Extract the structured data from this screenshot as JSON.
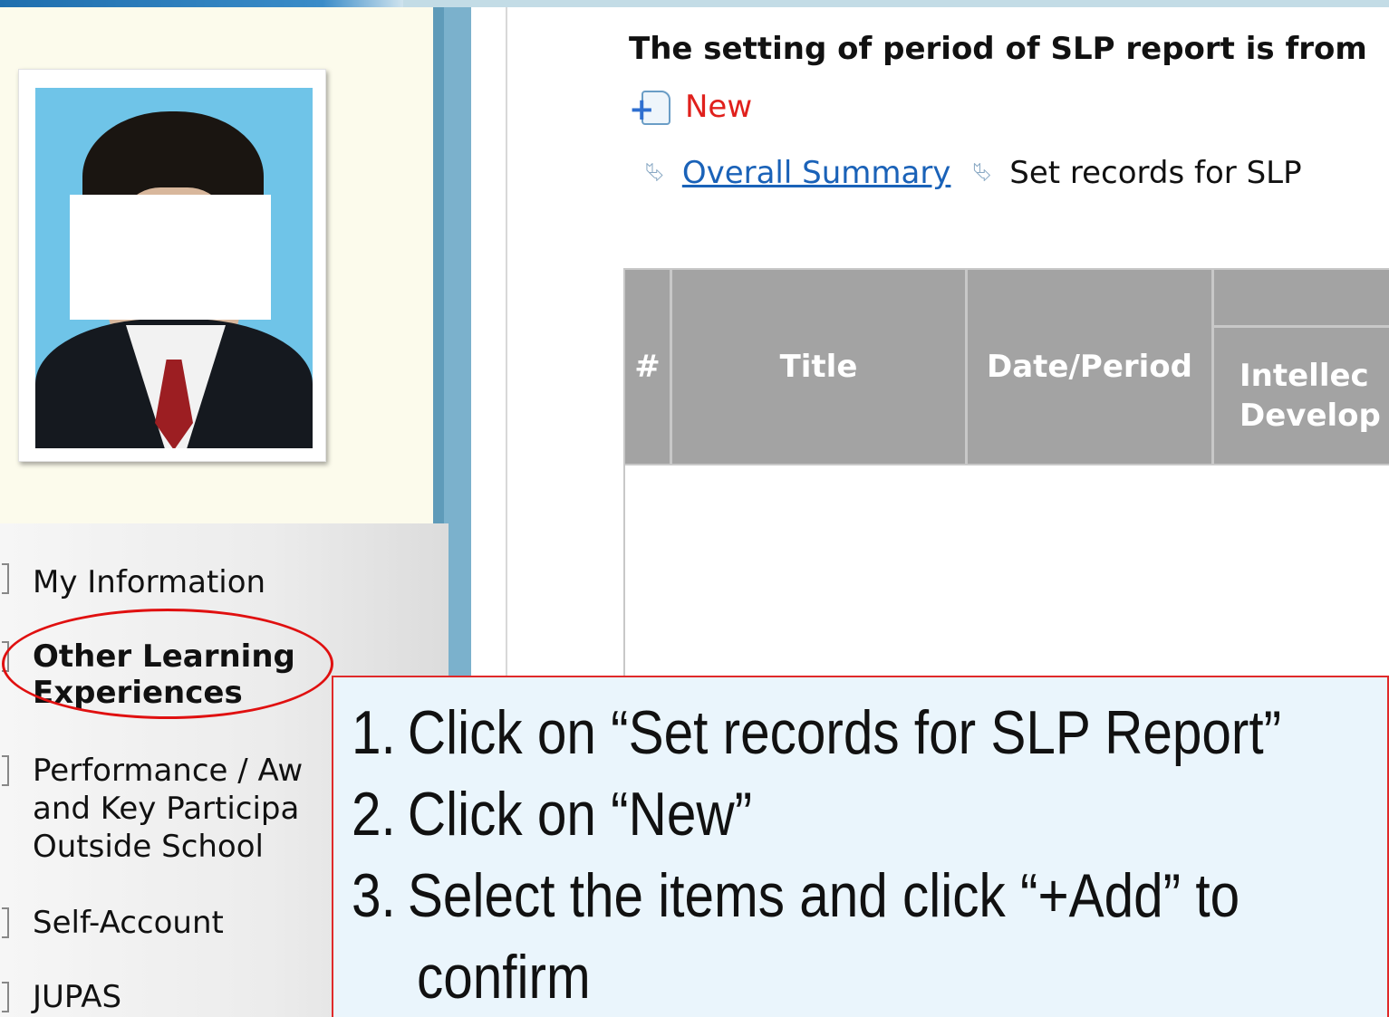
{
  "main": {
    "heading": "The setting of period of SLP report is from",
    "new_label": "New",
    "breadcrumb": {
      "link": "Overall Summary",
      "current": "Set records for SLP"
    }
  },
  "sidebar": {
    "items": [
      {
        "label": "My Information"
      },
      {
        "label_line1": "Other Learning",
        "label_line2": "Experiences"
      },
      {
        "label_line1": "Performance / Aw",
        "label_line2": "and Key Participa",
        "label_line3": "Outside School"
      },
      {
        "label": "Self-Account"
      },
      {
        "label": "JUPAS"
      }
    ]
  },
  "table": {
    "headers": [
      "#",
      "Title",
      "Date/Period"
    ],
    "sub_header_line1": "Intellec",
    "sub_header_line2": "Develop"
  },
  "instructions": {
    "items": [
      {
        "num": "1.",
        "text": "Click on “Set records for SLP Report”"
      },
      {
        "num": "2.",
        "text": "Click on “New”"
      },
      {
        "num": "3.",
        "text": "Select the items and click “+Add” to",
        "cont": "confirm"
      }
    ]
  },
  "colors": {
    "highlight": "#e01010",
    "link": "#1a62b8",
    "new": "#e0201c",
    "header_bg": "#a3a3a3",
    "instruction_bg": "#eaf5fc"
  }
}
